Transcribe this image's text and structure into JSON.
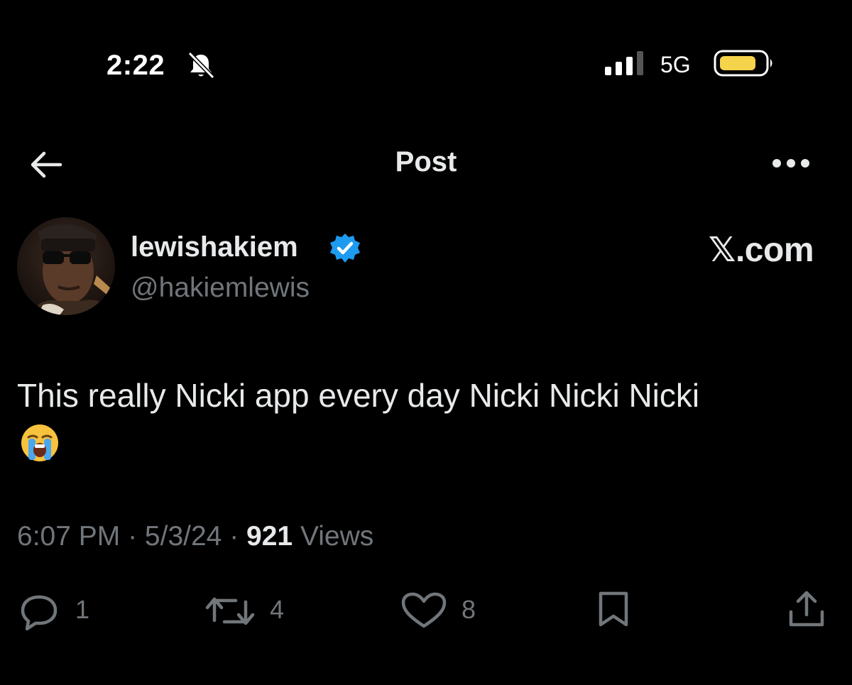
{
  "status_bar": {
    "time": "2:22",
    "network": "5G",
    "icons": [
      "bell-slash-icon",
      "signal-icon",
      "battery-icon"
    ],
    "battery_color": "#f5d34a"
  },
  "nav": {
    "title": "Post",
    "icons": [
      "back-arrow-icon",
      "more-icon"
    ]
  },
  "author": {
    "display_name": "lewishakiem",
    "handle": "@hakiemlewis",
    "verified_color": "#1d9bf0",
    "watermark": "𝕏.com"
  },
  "post": {
    "text": "This really Nicki app every day Nicki Nicki Nicki",
    "emoji": "😭"
  },
  "meta": {
    "time": "6:07 PM",
    "sep": " · ",
    "date": "5/3/24",
    "views": "921",
    "views_label": " Views"
  },
  "actions": {
    "replies": "1",
    "reposts": "4",
    "likes": "8",
    "icons": [
      "reply-icon",
      "repost-icon",
      "like-icon",
      "bookmark-icon",
      "share-icon"
    ]
  },
  "colors": {
    "background": "#000000",
    "text": "#e7e9ea",
    "secondary": "#71767b"
  }
}
